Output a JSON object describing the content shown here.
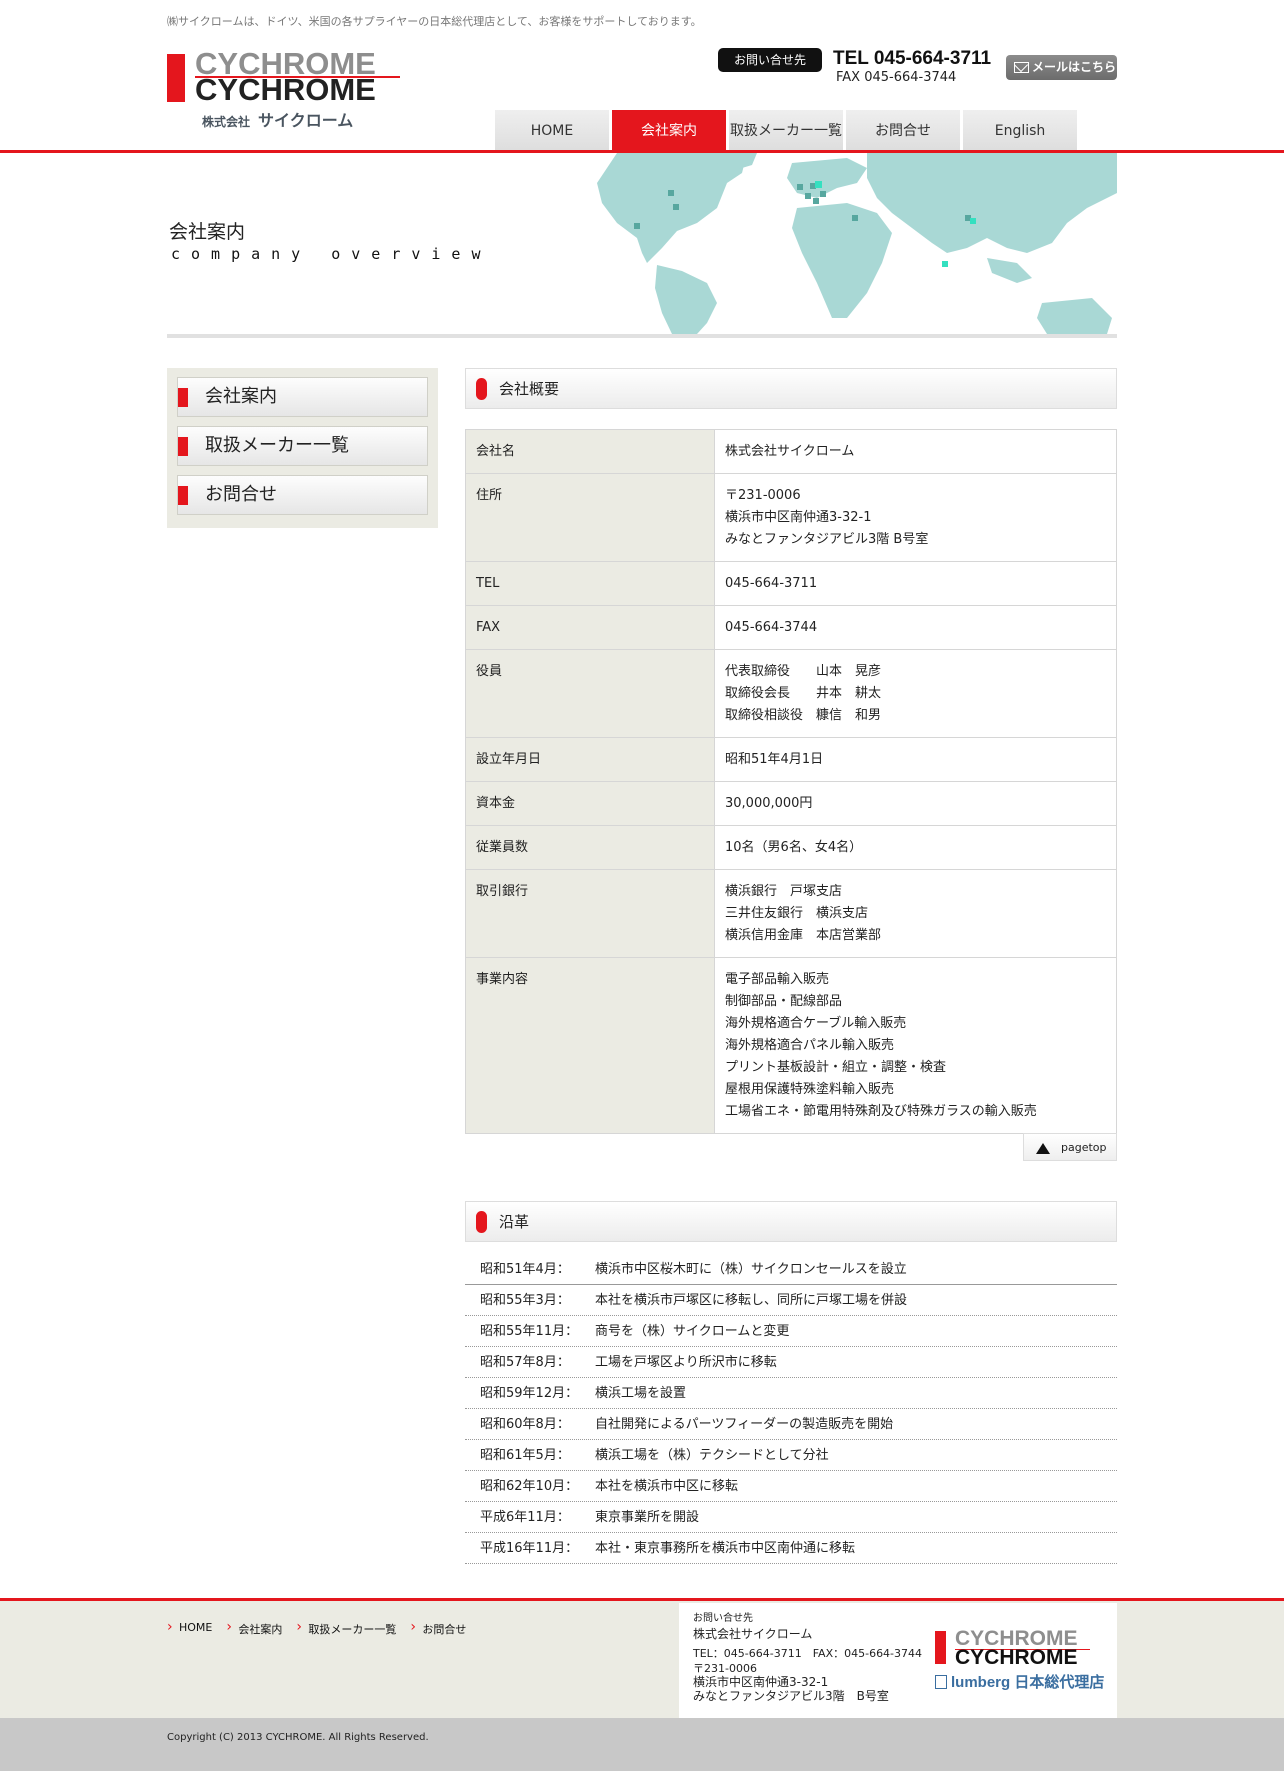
{
  "header": {
    "tagline": "㈱サイクロームは、ドイツ、米国の各サプライヤーの日本総代理店として、お客様をサポートしております。",
    "logo_en_1": "CYCHROME",
    "logo_en_2": "CYCHROME",
    "logo_jp_small": "株式会社",
    "logo_jp": "サイクローム",
    "contact_label": "お問い合せ先",
    "tel": "TEL 045-664-3711",
    "fax": "FAX 045-664-3744",
    "mail_button": "メールはこちら"
  },
  "nav": [
    "HOME",
    "会社案内",
    "取扱メーカー一覧",
    "お問合せ",
    "English"
  ],
  "nav_active_index": 1,
  "hero": {
    "title": "会社案内",
    "subtitle": "company overview"
  },
  "sidebar": [
    "会社案内",
    "取扱メーカー一覧",
    "お問合せ"
  ],
  "overview": {
    "heading": "会社概要",
    "rows": [
      {
        "k": "会社名",
        "v": [
          "株式会社サイクローム"
        ]
      },
      {
        "k": "住所",
        "v": [
          "〒231-0006",
          "横浜市中区南仲通3-32-1",
          "みなとファンタジアビル3階 B号室"
        ]
      },
      {
        "k": "TEL",
        "v": [
          "045-664-3711"
        ]
      },
      {
        "k": "FAX",
        "v": [
          "045-664-3744"
        ]
      },
      {
        "k": "役員",
        "v": [
          "代表取締役　　山本　晃彦",
          "取締役会長　　井本　耕太",
          "取締役相談役　糠信　和男"
        ]
      },
      {
        "k": "設立年月日",
        "v": [
          "昭和51年4月1日"
        ]
      },
      {
        "k": "資本金",
        "v": [
          "30,000,000円"
        ]
      },
      {
        "k": "従業員数",
        "v": [
          "10名（男6名、女4名）"
        ]
      },
      {
        "k": "取引銀行",
        "v": [
          "横浜銀行　戸塚支店",
          "三井住友銀行　横浜支店",
          "横浜信用金庫　本店営業部"
        ]
      },
      {
        "k": "事業内容",
        "v": [
          "電子部品輸入販売",
          "制御部品・配線部品",
          "海外規格適合ケーブル輸入販売",
          "海外規格適合パネル輸入販売",
          "プリント基板設計・組立・調整・検査",
          "屋根用保護特殊塗料輸入販売",
          "工場省エネ・節電用特殊剤及び特殊ガラスの輸入販売"
        ]
      }
    ]
  },
  "pagetop": "pagetop",
  "history": {
    "heading": "沿革",
    "rows": [
      {
        "d": "昭和51年4月：",
        "t": "横浜市中区桜木町に（株）サイクロンセールスを設立"
      },
      {
        "d": "昭和55年3月：",
        "t": "本社を横浜市戸塚区に移転し、同所に戸塚工場を併設"
      },
      {
        "d": "昭和55年11月：",
        "t": "商号を（株）サイクロームと変更"
      },
      {
        "d": "昭和57年8月：",
        "t": "工場を戸塚区より所沢市に移転"
      },
      {
        "d": "昭和59年12月：",
        "t": "横浜工場を設置"
      },
      {
        "d": "昭和60年8月：",
        "t": "自社開発によるパーツフィーダーの製造販売を開始"
      },
      {
        "d": "昭和61年5月：",
        "t": "横浜工場を（株）テクシードとして分社"
      },
      {
        "d": "昭和62年10月：",
        "t": "本社を横浜市中区に移転"
      },
      {
        "d": "平成6年11月：",
        "t": "東京事業所を開設"
      },
      {
        "d": "平成16年11月：",
        "t": "本社・東京事務所を横浜市中区南仲通に移転"
      }
    ]
  },
  "footer": {
    "links": [
      "HOME",
      "会社案内",
      "取扱メーカー一覧",
      "お問合せ"
    ],
    "contact_label": "お問い合せ先",
    "company": "株式会社サイクローム",
    "telfax": "TEL：045-664-3711　FAX：045-664-3744",
    "zip": "〒231-0006",
    "addr1": "横浜市中区南仲通3-32-1",
    "addr2": "みなとファンタジアビル3階　B号室",
    "logo_1": "CYCHROME",
    "logo_2": "CYCHROME",
    "lumberg": "lumberg 日本総代理店",
    "copyright": "Copyright (C) 2013 CYCHROME. All Rights Reserved."
  },
  "colors": {
    "accent": "#e4161d",
    "map": "#a9d8d5",
    "sidebar_bg": "#ebebe3"
  }
}
